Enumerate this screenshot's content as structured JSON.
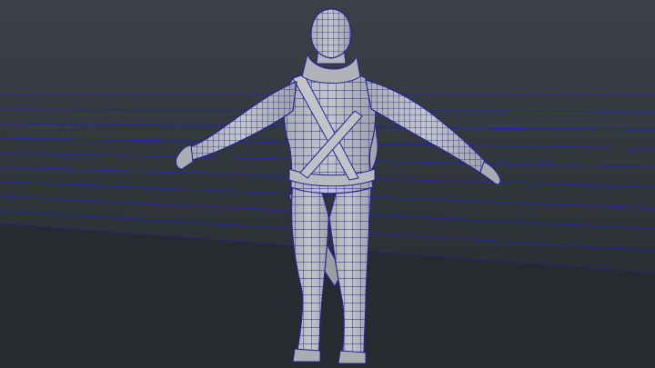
{
  "viewport": {
    "background_top": "#3b4147",
    "background_bottom": "#24282b",
    "floor_color": "#2b2f33",
    "grid_line_color": "#1f1fb8",
    "wire_color": "#24249a",
    "mesh_color": "#b4b6ba",
    "mesh_shade": "#8c8f95",
    "icons": {
      "grid": "ground-grid-icon",
      "model": "character-mesh-icon"
    }
  }
}
